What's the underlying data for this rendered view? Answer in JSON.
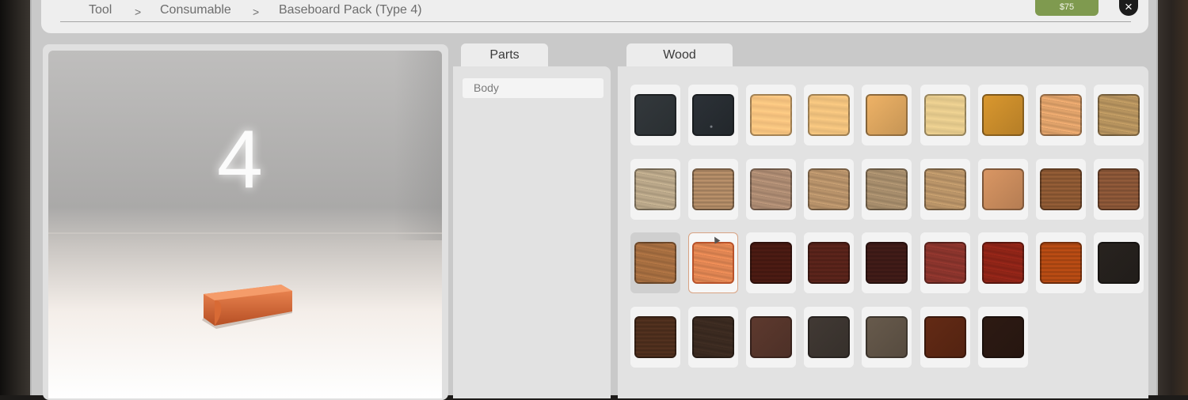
{
  "breadcrumb": {
    "items": [
      "Tool",
      "Consumable",
      "Baseboard Pack (Type 4)"
    ],
    "separator": ">"
  },
  "price": "$75",
  "close_icon": "close-icon",
  "preview": {
    "label": "4",
    "model": "orange wood baseboard piece"
  },
  "tabs": {
    "parts": "Parts",
    "wood": "Wood"
  },
  "parts": [
    {
      "label": "Body",
      "selected": true
    }
  ],
  "wood": {
    "hovered_index": 18,
    "selected_index": 19,
    "swatches": [
      {
        "color": "#2f3438"
      },
      {
        "color": "#262b30",
        "pattern": "dark-blank"
      },
      {
        "color": "#f6c27e",
        "pattern": "light-wood"
      },
      {
        "color": "#efc07c",
        "pattern": "light-wood"
      },
      {
        "color": "#dca55e"
      },
      {
        "color": "#e4c98c",
        "pattern": "light-wood"
      },
      {
        "color": "#c98c2b"
      },
      {
        "color": "#e0a26a",
        "pattern": "grain"
      },
      {
        "color": "#b6935e",
        "pattern": "grain"
      },
      {
        "color": "#b9a789",
        "pattern": "grain"
      },
      {
        "color": "#b28b66",
        "pattern": "stripes"
      },
      {
        "color": "#ad8b72",
        "pattern": "grain"
      },
      {
        "color": "#b7926a",
        "pattern": "grain"
      },
      {
        "color": "#a78d6c",
        "pattern": "grain"
      },
      {
        "color": "#b99468",
        "pattern": "grain"
      },
      {
        "color": "#c98b5c"
      },
      {
        "color": "#8f5a34",
        "pattern": "stripes"
      },
      {
        "color": "#8c5737",
        "pattern": "stripes"
      },
      {
        "color": "#a66e40",
        "pattern": "grain"
      },
      {
        "color": "#e08552",
        "pattern": "grain"
      },
      {
        "color": "#4a1a12",
        "pattern": "stripes"
      },
      {
        "color": "#59231a",
        "pattern": "stripes"
      },
      {
        "color": "#3f1b17",
        "pattern": "stripes"
      },
      {
        "color": "#8a342c",
        "pattern": "grain"
      },
      {
        "color": "#8e2417",
        "pattern": "grain"
      },
      {
        "color": "#b54a13",
        "pattern": "stripes"
      },
      {
        "color": "#25201d"
      },
      {
        "color": "#4f2f1d",
        "pattern": "stripes"
      },
      {
        "color": "#3b2a20",
        "pattern": "grain"
      },
      {
        "color": "#56352b"
      },
      {
        "color": "#3c3530"
      },
      {
        "color": "#5f5346"
      },
      {
        "color": "#5c2713"
      },
      {
        "color": "#2a1812"
      }
    ]
  }
}
